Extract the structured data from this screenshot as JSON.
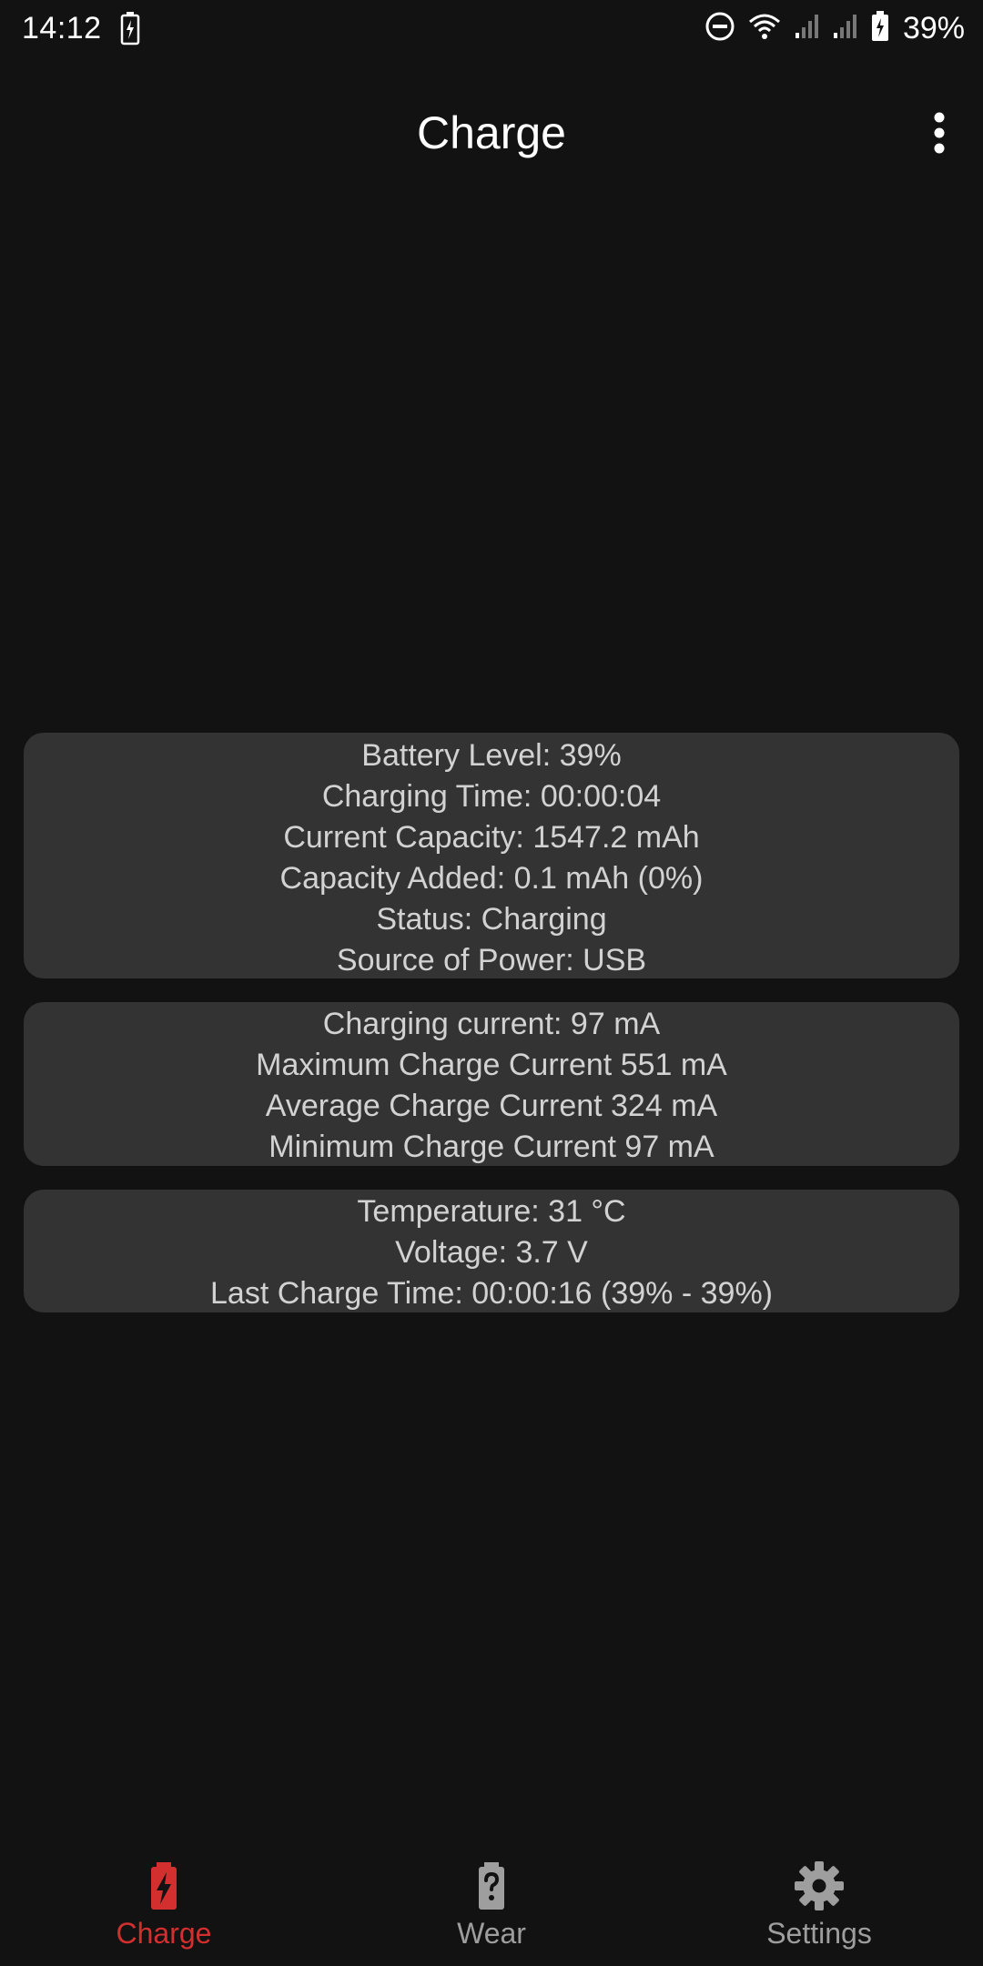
{
  "status_bar": {
    "time": "14:12",
    "battery_percent": "39%",
    "icons": [
      "battery-charging-icon",
      "do-not-disturb-icon",
      "wifi-icon",
      "signal-icon",
      "signal-icon",
      "battery-icon"
    ]
  },
  "app_bar": {
    "title": "Charge",
    "overflow_icon": "more-vert-icon"
  },
  "cards": {
    "battery": {
      "lines": [
        "Battery Level: 39%",
        "Charging Time: 00:00:04",
        "Current Capacity: 1547.2 mAh",
        "Capacity Added: 0.1 mAh (0%)",
        "Status: Charging",
        "Source of Power: USB"
      ]
    },
    "current": {
      "lines": [
        "Charging current: 97 mA",
        "Maximum Charge Current 551 mA",
        "Average Charge Current 324 mA",
        "Minimum Charge Current 97 mA"
      ]
    },
    "misc": {
      "lines": [
        "Temperature: 31 °C",
        "Voltage: 3.7 V",
        "Last Charge Time: 00:00:16 (39% - 39%)"
      ]
    }
  },
  "bottom_nav": {
    "items": [
      {
        "label": "Charge",
        "icon": "battery-charging-icon",
        "active": true
      },
      {
        "label": "Wear",
        "icon": "battery-unknown-icon",
        "active": false
      },
      {
        "label": "Settings",
        "icon": "gear-icon",
        "active": false
      }
    ]
  },
  "colors": {
    "background": "#121212",
    "card": "#333333",
    "card_text": "#d2d2d2",
    "accent": "#d32f2f",
    "inactive": "#9e9e9e"
  }
}
